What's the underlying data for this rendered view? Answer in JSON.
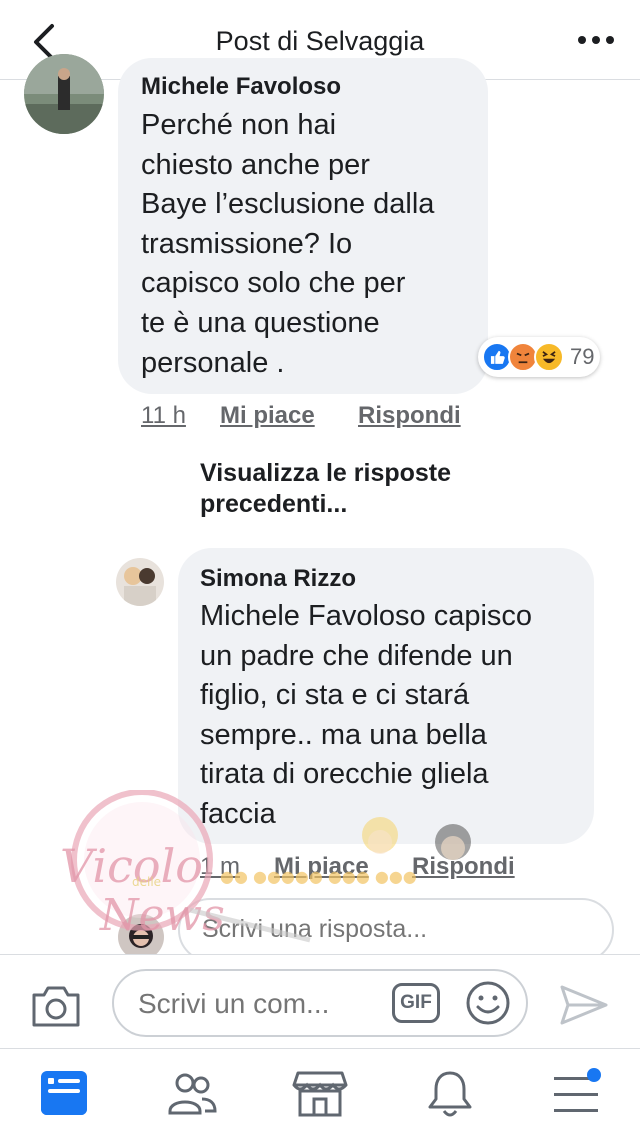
{
  "header": {
    "title": "Post di Selvaggia"
  },
  "comments": [
    {
      "author": "Michele Favoloso",
      "lines": [
        "Perché non hai",
        "chiesto anche per",
        "Baye l’esclusione dalla",
        "trasmissione? Io",
        "capisco solo che per",
        "te è una questione",
        "personale ."
      ],
      "time": "11 h",
      "like": "Mi piace",
      "reply": "Rispondi",
      "reaction_count": "79"
    }
  ],
  "previous_replies": [
    "Visualizza le risposte",
    "precedenti..."
  ],
  "replies": [
    {
      "author": "Simona Rizzo",
      "lines": [
        "Michele Favoloso capisco",
        "un padre che difende un",
        "figlio, ci sta e ci stará",
        "sempre.. ma una bella",
        "tirata di orecchie gliela",
        "faccia"
      ],
      "time": "1 m",
      "like": "Mi piace",
      "reply": "Rispondi"
    }
  ],
  "reply_box": {
    "placeholder": "Scrivi una risposta..."
  },
  "composer": {
    "placeholder": "Scrivi un com...",
    "gif": "GIF"
  },
  "watermark": {
    "text": "Vicolo delle News"
  },
  "colors": {
    "like_blue": "#1877f2",
    "angry": "#f0843b",
    "haha": "#f7b928",
    "notification_dot": "#1877f2"
  },
  "icons": [
    "back-icon",
    "more-icon",
    "camera-icon",
    "gif-icon",
    "emoji-icon",
    "send-icon",
    "news-feed-icon",
    "friends-icon",
    "marketplace-icon",
    "notifications-icon",
    "menu-icon"
  ]
}
